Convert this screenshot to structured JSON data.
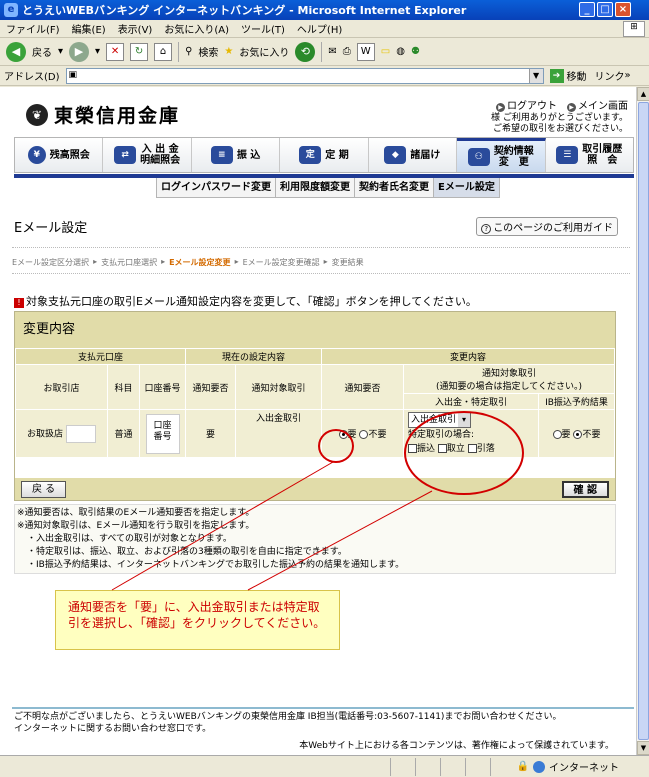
{
  "window": {
    "title": "とうえいWEBバンキング インターネットバンキング - Microsoft Internet Explorer",
    "buttons": {
      "minimize": "_",
      "maximize": "□",
      "close": "×"
    }
  },
  "menu": [
    "ファイル(F)",
    "編集(E)",
    "表示(V)",
    "お気に入り(A)",
    "ツール(T)",
    "ヘルプ(H)"
  ],
  "toolbar": {
    "back": "戻る",
    "search": "検索",
    "favorites": "お気に入り"
  },
  "address": {
    "label": "アドレス(D)",
    "value": "",
    "go": "移動",
    "links": "リンク"
  },
  "site": {
    "bank_name": "東榮信用金庫",
    "logo_glyph": "❦",
    "top_links": [
      "ログアウト",
      "メイン画面"
    ],
    "greeting_line1": "様 ご利用ありがとうございます。",
    "greeting_line2": "ご希望の取引をお選びください。"
  },
  "main_nav": [
    {
      "label": "残高照会",
      "icon": "yen-icon",
      "glyph": "¥"
    },
    {
      "label": "入 出 金\n明細照会",
      "icon": "transfer-icon",
      "glyph": "⇄"
    },
    {
      "label": "振 込",
      "icon": "money-icon",
      "glyph": "≡"
    },
    {
      "label": "定 期",
      "icon": "deposit-icon",
      "glyph": "定"
    },
    {
      "label": "諸届け",
      "icon": "diamond-icon",
      "glyph": "◆"
    },
    {
      "label": "契約情報\n変　更",
      "icon": "people-icon",
      "glyph": "⚇",
      "active": true
    },
    {
      "label": "取引履歴\n照　会",
      "icon": "list-icon",
      "glyph": "☰"
    }
  ],
  "sub_tabs": [
    "ログインパスワード変更",
    "利用限度額変更",
    "契約者氏名変更",
    "Eメール設定"
  ],
  "page_title": "Eメール設定",
  "guide_button": "このページのご利用ガイド",
  "steps": [
    "Eメール設定区分選択",
    "支払元口座選択",
    "Eメール設定変更",
    "Eメール設定変更確認",
    "変更結果"
  ],
  "current_step": 2,
  "instruction": "対象支払元口座の取引Eメール通知設定内容を変更して、「確認」ボタンを押してください。",
  "change": {
    "section_title": "変更内容",
    "headers": {
      "account_group": "支払元口座",
      "current_group": "現在の設定内容",
      "change_group": "変更内容",
      "branch": "お取引店",
      "type": "科目",
      "number": "口座番号",
      "notify": "通知要否",
      "target": "通知対象取引",
      "notify_new": "通知要否",
      "target_new_1": "通知対象取引",
      "target_new_2": "(通知要の場合は指定してください。)",
      "inout_specific": "入出金・特定取引",
      "ib_result": "IB振込予約結果"
    },
    "row": {
      "branch": "お取扱店",
      "type": "普通",
      "number": "口座\n番号",
      "notify": "要",
      "target": "入出金取引",
      "radio_yes": "要",
      "radio_no": "不要",
      "select_value": "入出金取引",
      "specific_label": "特定取引の場合:",
      "checks": [
        "振込",
        "取立",
        "引落"
      ],
      "ib_yes": "要",
      "ib_no": "不要"
    },
    "back_button": "戻 る",
    "confirm_button": "確 認"
  },
  "notes": [
    "※通知要否は、取引結果のEメール通知要否を指定します。",
    "※通知対象取引は、Eメール通知を行う取引を指定します。",
    "・入出金取引は、すべての取引が対象となります。",
    "・特定取引は、振込、取立、および引落の3種類の取引を自由に指定できます。",
    "・IB振込予約結果は、インターネットバンキングでお取引した振込予約の結果を通知します。"
  ],
  "callout": "通知要否を「要」に、入出金取引または特定取引を選択し、「確認」をクリックしてください。",
  "footer": {
    "line1": "ご不明な点がございましたら、とうえいWEBバンキングの東榮信用金庫 IB担当(電話番号:03-5607-1141)までお問い合わせください。",
    "line2": "インターネットに関するお問い合わせ窓口です。",
    "copyright": "本Webサイト上における各コンテンツは、著作権によって保護されています。"
  },
  "status": {
    "zone": "インターネット"
  }
}
